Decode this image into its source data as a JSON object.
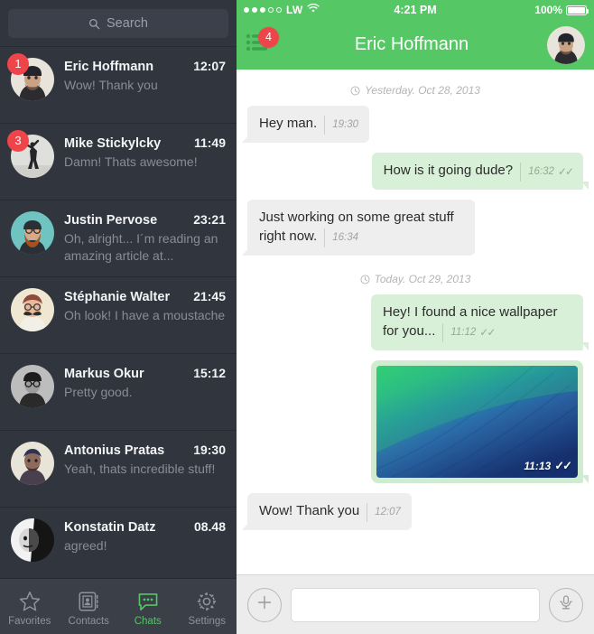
{
  "sidebar": {
    "search": {
      "placeholder": "Search",
      "icon": "search-icon"
    },
    "chats": [
      {
        "name": "Eric Hoffmann",
        "time": "12:07",
        "preview": "Wow! Thank you",
        "badge": "1"
      },
      {
        "name": "Mike Stickylcky",
        "time": "11:49",
        "preview": "Damn! Thats awesome!",
        "badge": "3"
      },
      {
        "name": "Justin Pervose",
        "time": "23:21",
        "preview": "Oh, alright... I´m reading an amazing article at...",
        "badge": ""
      },
      {
        "name": "Stéphanie Walter",
        "time": "21:45",
        "preview": "Oh look! I have a moustache",
        "badge": ""
      },
      {
        "name": "Markus Okur",
        "time": "15:12",
        "preview": "Pretty good.",
        "badge": ""
      },
      {
        "name": "Antonius Pratas",
        "time": "19:30",
        "preview": "Yeah, thats incredible stuff!",
        "badge": ""
      },
      {
        "name": "Konstatin Datz",
        "time": "08.48",
        "preview": "agreed!",
        "badge": ""
      }
    ],
    "tabs": [
      {
        "label": "Favorites",
        "icon": "star-icon",
        "active": false
      },
      {
        "label": "Contacts",
        "icon": "contact-card-icon",
        "active": false
      },
      {
        "label": "Chats",
        "icon": "chat-bubble-icon",
        "active": true
      },
      {
        "label": "Settings",
        "icon": "gear-icon",
        "active": false
      }
    ]
  },
  "statusbar": {
    "carrier": "LW",
    "signal_dots_filled": 3,
    "signal_dots_total": 5,
    "wifi_icon": "wifi-icon",
    "time": "4:21 PM",
    "battery_percent": "100%",
    "battery_level": 100
  },
  "header": {
    "title": "Eric Hoffmann",
    "menu_icon": "list-menu-icon",
    "menu_badge": "4",
    "avatar": "contact-avatar"
  },
  "conversation": [
    {
      "kind": "date",
      "label": "Yesterday. Oct 28, 2013",
      "icon": "clock-icon"
    },
    {
      "kind": "text",
      "dir": "in",
      "text": "Hey man.",
      "time": "19:30",
      "ticks": ""
    },
    {
      "kind": "text",
      "dir": "out",
      "text": "How is it going dude?",
      "time": "16:32",
      "ticks": "✓✓"
    },
    {
      "kind": "text",
      "dir": "in",
      "text": "Just working on some great stuff right now.",
      "time": "16:34",
      "ticks": ""
    },
    {
      "kind": "date",
      "label": "Today. Oct 29, 2013",
      "icon": "clock-icon"
    },
    {
      "kind": "text",
      "dir": "out",
      "text": "Hey! I found a nice wallpaper for you...",
      "time": "11:12",
      "ticks": "✓✓"
    },
    {
      "kind": "image",
      "dir": "out",
      "alt": "wave-wallpaper-photo",
      "time": "11:13",
      "ticks": "✓✓"
    },
    {
      "kind": "text",
      "dir": "in",
      "text": "Wow! Thank you",
      "time": "12:07",
      "ticks": ""
    }
  ],
  "composer": {
    "attach_icon": "plus-icon",
    "input_value": "",
    "input_placeholder": "",
    "mic_icon": "microphone-icon"
  },
  "colors": {
    "brand_green": "#55c764",
    "sidebar_bg": "#31353d",
    "tabbar_bg": "#3a3f48",
    "badge_red": "#f0444b",
    "bubble_in": "#eeeeee",
    "bubble_out": "#d9f0d8",
    "image_frame": "#cfecd0",
    "composer_bg": "#ececec"
  }
}
